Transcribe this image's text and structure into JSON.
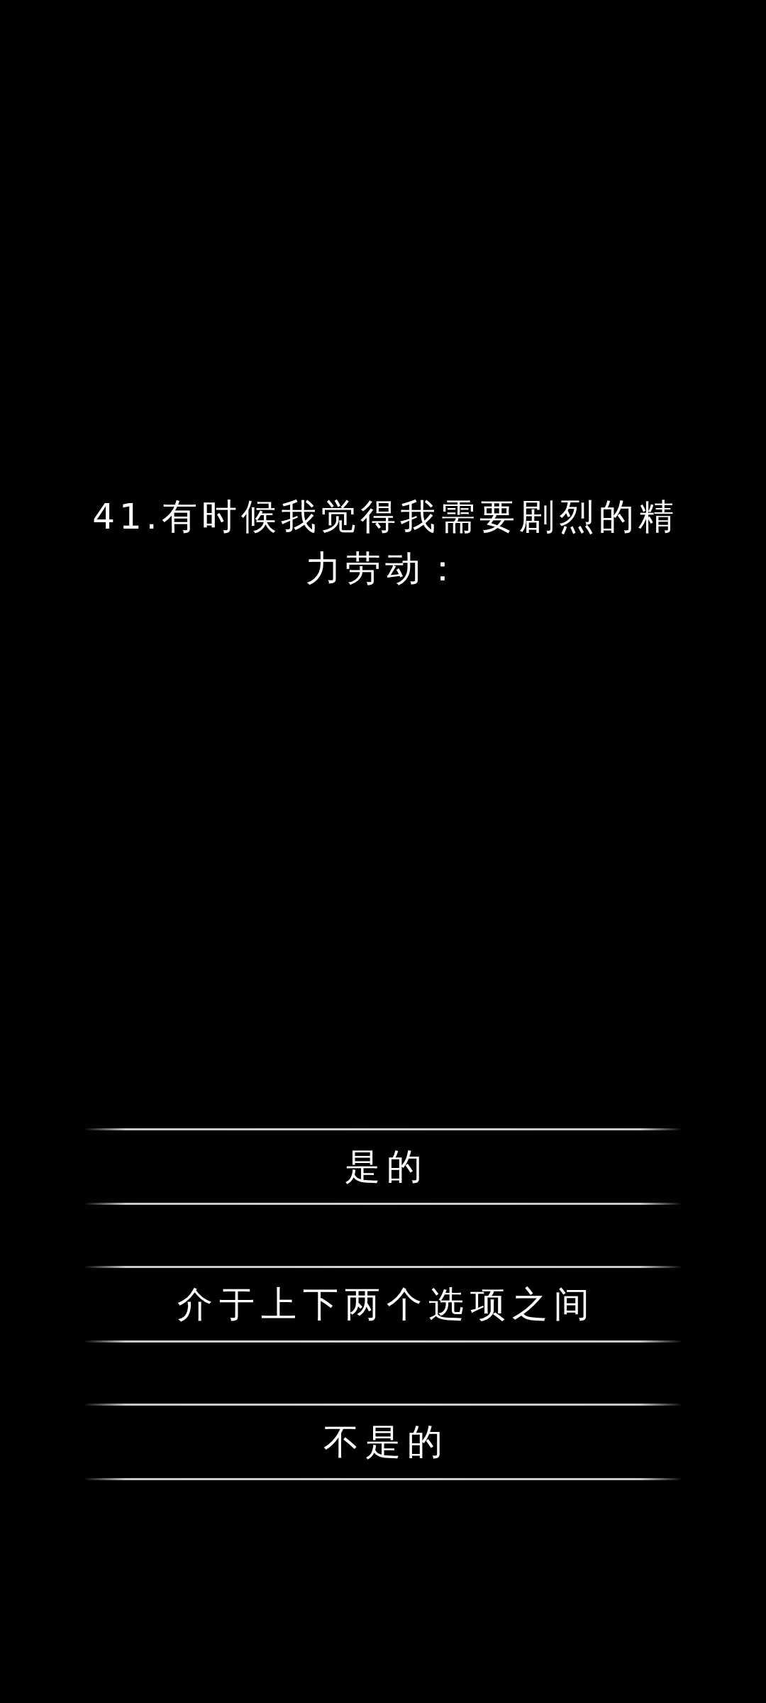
{
  "question": {
    "text": "41.有时候我觉得我需要剧烈的精力劳动："
  },
  "options": [
    "是的",
    "介于上下两个选项之间",
    "不是的"
  ]
}
